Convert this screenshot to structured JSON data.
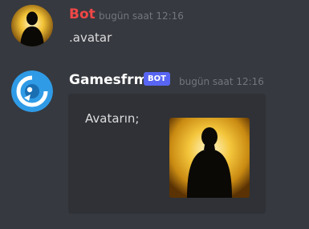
{
  "messages": [
    {
      "author": "Bot",
      "author_color": "#f04747",
      "timestamp": "bugün saat 12:16",
      "content": ".avatar",
      "avatar_icon": "silhouette-avatar-icon"
    },
    {
      "author": "Gamesfrm",
      "author_color": "#ffffff",
      "bot_tag": "BOT",
      "timestamp": "bugün saat 12:16",
      "avatar_icon": "gamesfrm-logo-icon",
      "embed": {
        "description": "Avatarın;",
        "thumbnail_icon": "silhouette-avatar-icon"
      }
    }
  ],
  "colors": {
    "background": "#36393f",
    "embed_background": "#2f3136",
    "bot_tag": "#5865f2",
    "text": "#dcddde",
    "muted": "#72767d"
  }
}
